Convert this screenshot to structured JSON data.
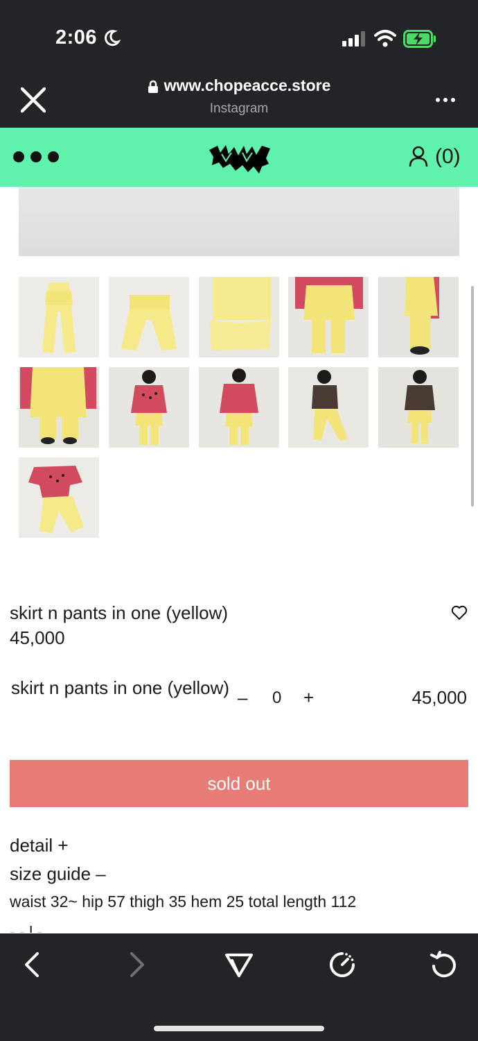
{
  "status_bar": {
    "time": "2:06"
  },
  "browser": {
    "url": "www.chopeacce.store",
    "source": "Instagram"
  },
  "site_header": {
    "brand_color": "#5ff2ac",
    "cart_count": "(0)"
  },
  "product": {
    "name": "skirt n pants in one (yellow)",
    "price": "45,000",
    "option": {
      "name": "skirt n pants in one (yellow)",
      "minus": "–",
      "quantity": "0",
      "plus": "+",
      "price": "45,000"
    },
    "sold_out_label": "sold out",
    "sold_out_color": "#e77b76",
    "detail_label": "detail +",
    "size_guide_label": "size guide –",
    "size_text": "waist 32~ hip 57 thigh 35 hem 25 total length 112",
    "cut_off_text": "- - l -"
  },
  "thumbnails": [
    {
      "name": "thumb-1",
      "desc": "flat-lay-full"
    },
    {
      "name": "thumb-2",
      "desc": "flat-lay-folded"
    },
    {
      "name": "thumb-3",
      "desc": "fabric-close-up"
    },
    {
      "name": "thumb-4",
      "desc": "worn-waist-down"
    },
    {
      "name": "thumb-5",
      "desc": "worn-side"
    },
    {
      "name": "thumb-6",
      "desc": "worn-close-up"
    },
    {
      "name": "thumb-7",
      "desc": "model-pink-sweater-front"
    },
    {
      "name": "thumb-8",
      "desc": "model-pink-sweater-back"
    },
    {
      "name": "thumb-9",
      "desc": "model-brown-sweater-side"
    },
    {
      "name": "thumb-10",
      "desc": "model-brown-sweater-front"
    },
    {
      "name": "thumb-11",
      "desc": "outfit-flat-lay"
    }
  ],
  "toolbar": {
    "icons": [
      "back-icon",
      "forward-icon",
      "share-icon",
      "speed-icon",
      "reload-icon"
    ]
  }
}
